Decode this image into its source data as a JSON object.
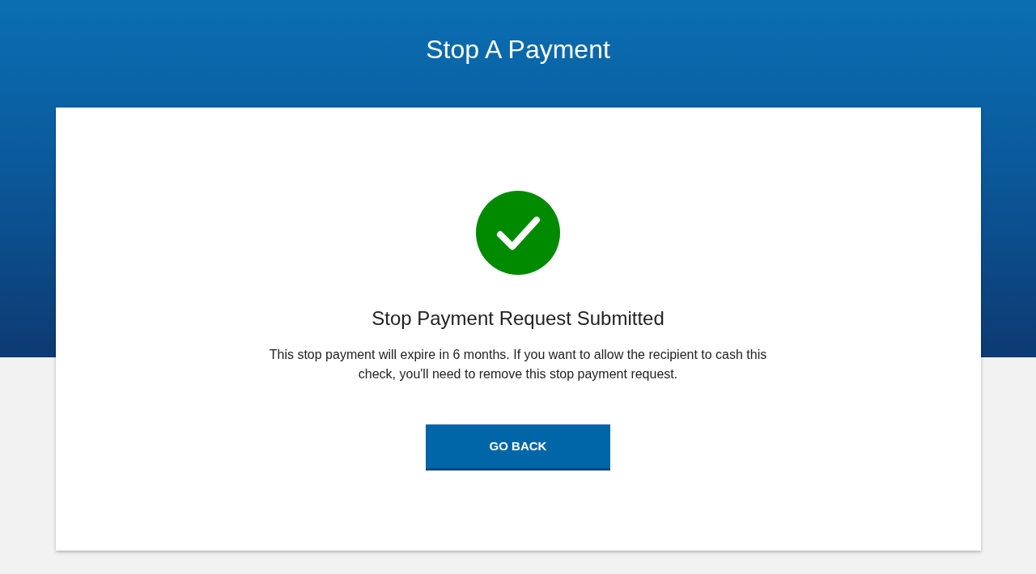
{
  "page_title": "Stop A Payment",
  "confirmation": {
    "heading": "Stop Payment Request Submitted",
    "message": "This stop payment will expire in 6 months. If you want to allow the recipient to cash this check, you'll need to remove this stop payment request.",
    "button": "GO BACK"
  }
}
